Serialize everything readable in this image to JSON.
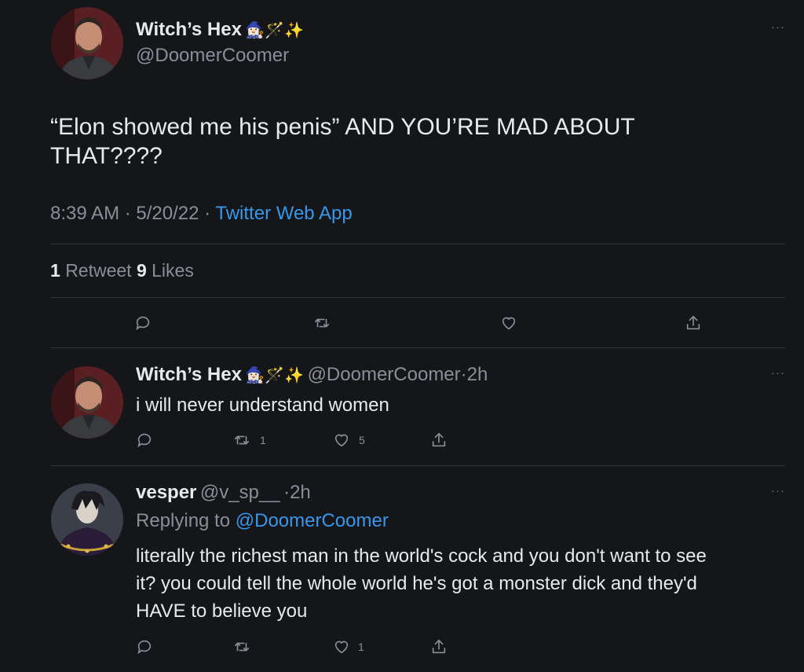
{
  "main_tweet": {
    "display_name": "Witch’s Hex",
    "name_emoji": "🧙🏻‍♀️🪄✨",
    "handle": "@DoomerCoomer",
    "text_line1": "“Elon showed me his penis” AND YOU’RE MAD ABOUT",
    "text_line2": "THAT????",
    "time": "8:39 AM",
    "sep1": "·",
    "date": "5/20/22",
    "sep2": "·",
    "source": "Twitter Web App",
    "retweets_count": "1",
    "retweets_label": "Retweet",
    "likes_count": "9",
    "likes_label": "Likes",
    "more": "···"
  },
  "reply1": {
    "display_name": "Witch’s Hex",
    "name_emoji": "🧙🏻‍♀️🪄✨",
    "handle": "@DoomerCoomer",
    "sep": "·",
    "age": "2h",
    "text": "i will never understand women",
    "retweet_count": "1",
    "like_count": "5",
    "more": "···"
  },
  "reply2": {
    "display_name": "vesper",
    "handle": "@v_sp__",
    "sep": "·",
    "age": "2h",
    "replying_label": "Replying to",
    "replying_to": "@DoomerCoomer",
    "text_line1": "literally the richest man in the world's cock and you don't want to see",
    "text_line2": "it? you could tell the whole world he's got a monster dick and they'd",
    "text_line3": "HAVE to believe you",
    "like_count": "1",
    "more": "···"
  },
  "colors": {
    "background": "#15161a",
    "text": "#e7e9ea",
    "muted": "#8b8f94",
    "link": "#3897e8",
    "divider": "#2f3336"
  },
  "icons": [
    "reply-icon",
    "retweet-icon",
    "like-icon",
    "share-icon",
    "more-icon"
  ]
}
